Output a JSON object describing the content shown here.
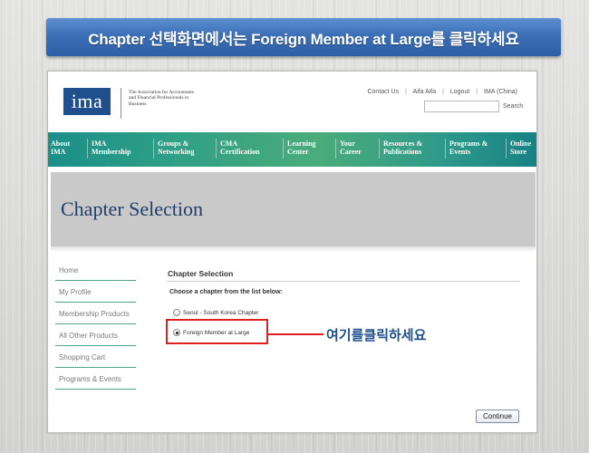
{
  "banner": {
    "text": "Chapter 선택화면에서는 Foreign Member at Large를 클릭하세요"
  },
  "header": {
    "logo_text": "ima",
    "tagline": "The Association for Accountants and Financial Professionals in Business",
    "top_links": [
      "Contact Us",
      "Aifa Aifa",
      "Logout",
      "IMA (China)"
    ],
    "search_placeholder": "",
    "search_label": "Search"
  },
  "nav": {
    "items": [
      {
        "line1": "About",
        "line2": "IMA"
      },
      {
        "line1": "IMA",
        "line2": "Membership"
      },
      {
        "line1": "Groups &",
        "line2": "Networking"
      },
      {
        "line1": "CMA",
        "line2": "Certification"
      },
      {
        "line1": "Learning",
        "line2": "Center"
      },
      {
        "line1": "Your",
        "line2": "Career"
      },
      {
        "line1": "Resources &",
        "line2": "Publications"
      },
      {
        "line1": "Programs &",
        "line2": "Events"
      },
      {
        "line1": "Online",
        "line2": "Store"
      }
    ]
  },
  "hero": {
    "title": "Chapter Selection"
  },
  "sidebar": {
    "items": [
      "Home",
      "My Profile",
      "Membership Products",
      "All Other Products",
      "Shopping Cart",
      "Programs & Events"
    ]
  },
  "main": {
    "section_title": "Chapter Selection",
    "prompt": "Choose a chapter from the list below:",
    "options": [
      {
        "label": "Seoul - South Korea Chapter",
        "selected": false
      },
      {
        "label": "Foreign Member at Large",
        "selected": true
      }
    ],
    "continue_label": "Continue"
  },
  "callout": {
    "text": "여기를클릭하세요",
    "color": "#e02020"
  },
  "colors": {
    "banner": "#3b6fb6",
    "nav_teal": "#2f9f86",
    "logo_navy": "#1f4f8c"
  }
}
